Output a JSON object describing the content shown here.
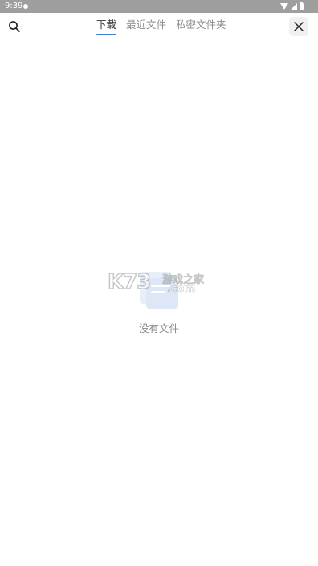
{
  "status_bar": {
    "time": "9:39",
    "icons": [
      "notification-dot-icon",
      "wifi-icon",
      "signal-icon",
      "battery-icon"
    ]
  },
  "header": {
    "search_icon": "search-icon",
    "close_icon": "close-icon",
    "tabs": [
      {
        "label": "下载",
        "active": true
      },
      {
        "label": "最近文件",
        "active": false
      },
      {
        "label": "私密文件夹",
        "active": false
      }
    ]
  },
  "empty_state": {
    "illustration_icon": "empty-folder-icon",
    "message": "没有文件"
  },
  "watermark": {
    "logo": "K73",
    "site_cn": "游戏之家",
    "site_domain": ".com"
  },
  "colors": {
    "status_bar_bg": "#9e9e9e",
    "accent": "#3b82d9",
    "active_text": "#333333",
    "inactive_text": "#8a8a8a",
    "illustration": "#e8eff9"
  }
}
